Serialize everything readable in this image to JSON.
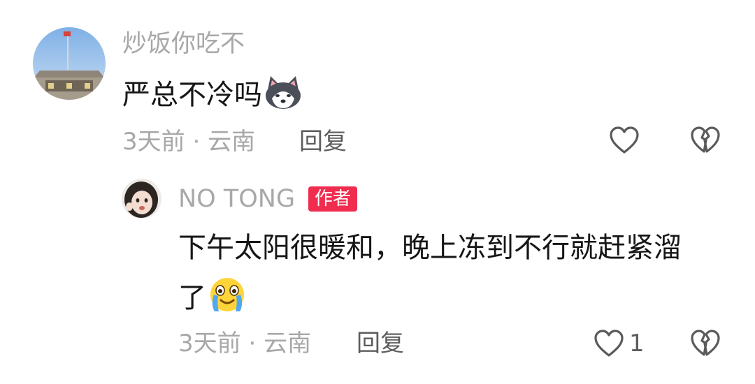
{
  "comments": [
    {
      "username": "炒饭你吃不",
      "text": "严总不冷吗",
      "emoji": "husky-emoji",
      "time": "3天前",
      "separator": "·",
      "location": "云南",
      "reply_label": "回复",
      "like_count": ""
    }
  ],
  "reply": {
    "username": "NO TONG",
    "badge": "作者",
    "text_line1": "下午太阳很暖和，晚上冻到不行就赶紧溜",
    "text_line2": "了",
    "emoji": "crying-smile-emoji",
    "time": "3天前",
    "separator": "·",
    "location": "云南",
    "reply_label": "回复",
    "like_count": "1"
  },
  "colors": {
    "secondary_text": "#a8a8a8",
    "primary_text": "#161616",
    "action_text": "#5c5c5c",
    "author_badge": "#f02c4f",
    "icon_stroke": "#5a5a5a"
  }
}
